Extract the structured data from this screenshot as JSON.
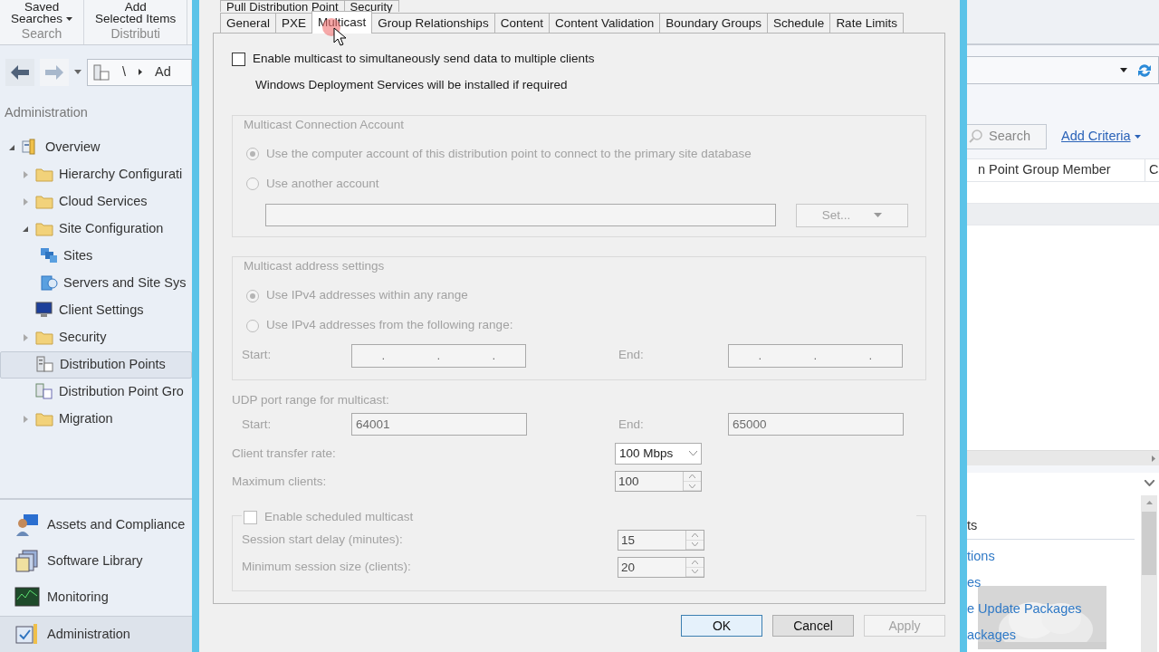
{
  "left_pane": {
    "ribbon": {
      "buttons": [
        {
          "label": "Saved",
          "sublabel": "Searches",
          "dropdown": true
        },
        {
          "label": "Add",
          "sublabel": "Selected Items",
          "dropdown": false
        }
      ],
      "groups": [
        "Search",
        "Distributi"
      ]
    },
    "breadcrumb": [
      "\\",
      "Ad"
    ],
    "workspace_title": "Administration",
    "tree": [
      {
        "label": "Overview",
        "kind": "overview",
        "expanded": true,
        "selected": false,
        "children": [
          {
            "label": "Hierarchy Configurati",
            "kind": "folder",
            "expanded": false,
            "selected": false
          },
          {
            "label": "Cloud Services",
            "kind": "folder",
            "expanded": false,
            "selected": false
          },
          {
            "label": "Site Configuration",
            "kind": "folder",
            "expanded": true,
            "selected": false,
            "children": [
              {
                "label": "Sites",
                "kind": "sites",
                "selected": false
              },
              {
                "label": "Servers and Site Sys",
                "kind": "servers",
                "selected": false
              }
            ]
          },
          {
            "label": "Client Settings",
            "kind": "monitor",
            "selected": false
          },
          {
            "label": "Security",
            "kind": "folder",
            "expanded": false,
            "selected": false
          },
          {
            "label": "Distribution Points",
            "kind": "dp",
            "selected": true
          },
          {
            "label": "Distribution Point Gro",
            "kind": "dpg",
            "selected": false
          },
          {
            "label": "Migration",
            "kind": "folder",
            "expanded": false,
            "selected": false
          }
        ]
      }
    ],
    "workspaces": [
      {
        "label": "Assets and Compliance",
        "kind": "assets",
        "selected": false
      },
      {
        "label": "Software Library",
        "kind": "library",
        "selected": false
      },
      {
        "label": "Monitoring",
        "kind": "monitoring",
        "selected": false
      },
      {
        "label": "Administration",
        "kind": "admin",
        "selected": true
      }
    ]
  },
  "dialog": {
    "tab_rows": [
      [
        {
          "label": "Pull Distribution Point",
          "selected": false
        },
        {
          "label": "Security",
          "selected": false
        }
      ],
      [
        {
          "label": "General",
          "selected": false
        },
        {
          "label": "PXE",
          "selected": false
        },
        {
          "label": "Multicast",
          "selected": true
        },
        {
          "label": "Group Relationships",
          "selected": false
        },
        {
          "label": "Content",
          "selected": false
        },
        {
          "label": "Content Validation",
          "selected": false
        },
        {
          "label": "Boundary Groups",
          "selected": false
        },
        {
          "label": "Schedule",
          "selected": false
        },
        {
          "label": "Rate Limits",
          "selected": false
        }
      ]
    ],
    "enable_multicast": {
      "label": "Enable multicast to simultaneously send data to multiple clients",
      "checked": false
    },
    "note": "Windows Deployment Services will be installed if required",
    "connection_account": {
      "title": "Multicast Connection Account",
      "disabled": true,
      "options": [
        {
          "label": "Use the computer account of this distribution point to connect to the primary site database",
          "selected": true
        },
        {
          "label": "Use another account",
          "selected": false
        }
      ],
      "set_button": "Set..."
    },
    "address_settings": {
      "title": "Multicast address settings",
      "disabled": true,
      "options": [
        {
          "label": "Use IPv4 addresses within any range",
          "selected": true
        },
        {
          "label": "Use IPv4 addresses from the following range:",
          "selected": false
        }
      ],
      "start_label": "Start:",
      "end_label": "End:",
      "ip_separator": "."
    },
    "udp": {
      "title": "UDP port range for multicast:",
      "start_label": "Start:",
      "start": "64001",
      "end_label": "End:",
      "end": "65000"
    },
    "fields": [
      {
        "kind": "select",
        "label": "Client transfer rate:",
        "value": "100 Mbps",
        "disabled": false
      },
      {
        "kind": "spin",
        "label": "Maximum clients:",
        "value": "100",
        "disabled": true
      }
    ],
    "scheduled": {
      "label": "Enable scheduled multicast",
      "checked": false,
      "disabled": true,
      "fields": [
        {
          "label": "Session start delay (minutes):",
          "value": "15"
        },
        {
          "label": "Minimum session size (clients):",
          "value": "20"
        }
      ]
    },
    "buttons": [
      {
        "label": "OK",
        "disabled": false,
        "default": true
      },
      {
        "label": "Cancel",
        "disabled": false,
        "default": false
      },
      {
        "label": "Apply",
        "disabled": true,
        "default": false
      }
    ]
  },
  "right_pane": {
    "search_placeholder": "Search",
    "add_criteria": "Add Criteria",
    "columns": [
      "n Point Group Member",
      "C"
    ],
    "links": [
      {
        "label": "ts",
        "kind": "heading"
      },
      {
        "label": "tions",
        "kind": "link"
      },
      {
        "label": "es",
        "kind": "link"
      },
      {
        "label": "e Update Packages",
        "kind": "link"
      },
      {
        "label": "ackages",
        "kind": "link"
      }
    ]
  }
}
